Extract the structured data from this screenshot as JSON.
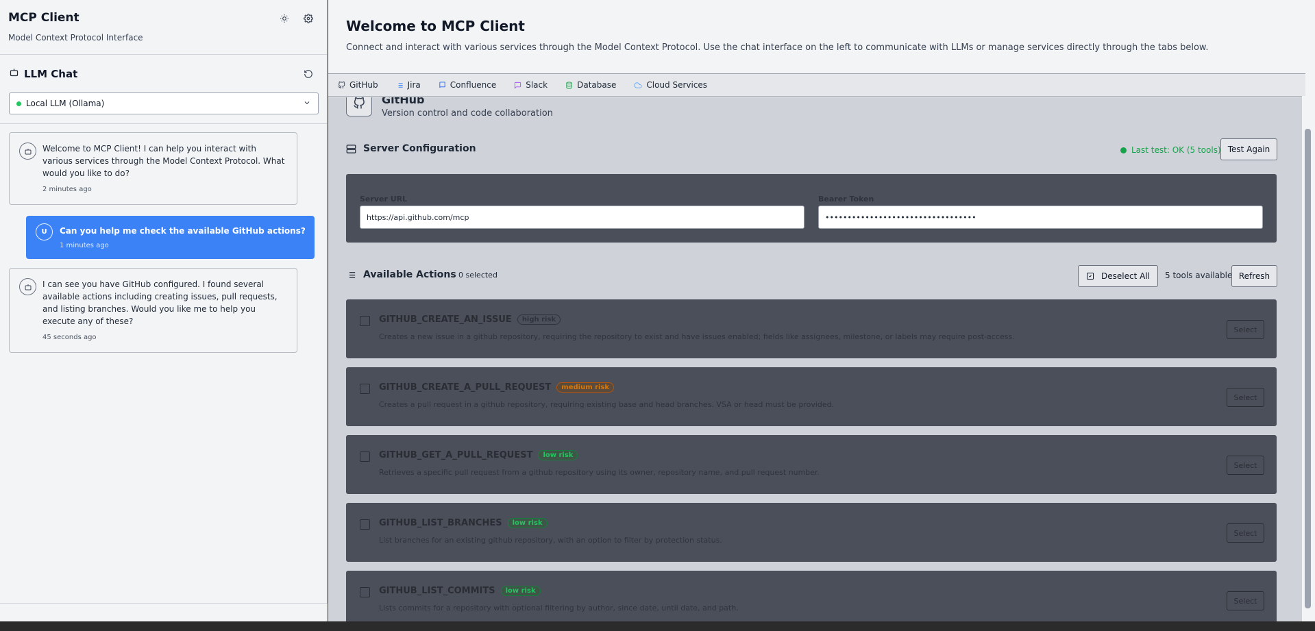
{
  "sidebar": {
    "title": "MCP Client",
    "subtitle": "Model Context Protocol Interface",
    "chat": {
      "title": "LLM Chat",
      "model_select": "Local LLM (Ollama)"
    },
    "messages": [
      {
        "role": "bot",
        "avatar": "",
        "text": "Welcome to MCP Client! I can help you interact with various services through the Model Context Protocol. What would you like to do?",
        "time": "2 minutes ago"
      },
      {
        "role": "user",
        "avatar": "U",
        "text": "Can you help me check the available GitHub actions?",
        "time": "1 minutes ago"
      },
      {
        "role": "bot",
        "avatar": "",
        "text": "I can see you have GitHub configured. I found several available actions including creating issues, pull requests, and listing branches. Would you like me to help you execute any of these?",
        "time": "45 seconds ago"
      }
    ]
  },
  "main": {
    "title": "Welcome to MCP Client",
    "subtitle": "Connect and interact with various services through the Model Context Protocol. Use the chat interface on the left to communicate with LLMs or manage services directly through the tabs below.",
    "tabs": [
      {
        "label": "GitHub",
        "icon": "github-icon"
      },
      {
        "label": "Jira",
        "icon": "list-icon"
      },
      {
        "label": "Confluence",
        "icon": "book-icon"
      },
      {
        "label": "Slack",
        "icon": "chat-icon"
      },
      {
        "label": "Database",
        "icon": "database-icon"
      },
      {
        "label": "Cloud Services",
        "icon": "cloud-icon"
      }
    ],
    "service": {
      "name": "GitHub",
      "description": "Version control and code collaboration"
    },
    "server_config": {
      "title": "Server Configuration",
      "status": "Last test: OK (5 tools)",
      "test_button": "Test Again",
      "url_label": "Server URL",
      "url_value": "https://api.github.com/mcp",
      "token_label": "Bearer Token",
      "token_value": "••••••••••••••••••••••••••••••••••"
    },
    "actions": {
      "title": "Available Actions",
      "selected_count": "0 selected",
      "deselect_button": "Deselect All",
      "tools_available": "5 tools available",
      "refresh_button": "Refresh",
      "select_label": "Select",
      "items": [
        {
          "name": "GITHUB_CREATE_AN_ISSUE",
          "risk": "high risk",
          "level": "high",
          "description": "Creates a new issue in a github repository, requiring the repository to exist and have issues enabled; fields like assignees, milestone, or labels may require post-access."
        },
        {
          "name": "GITHUB_CREATE_A_PULL_REQUEST",
          "risk": "medium risk",
          "level": "medium",
          "description": "Creates a pull request in a github repository, requiring existing base and head branches. VSA or head must be provided."
        },
        {
          "name": "GITHUB_GET_A_PULL_REQUEST",
          "risk": "low risk",
          "level": "low",
          "description": "Retrieves a specific pull request from a github repository using its owner, repository name, and pull request number."
        },
        {
          "name": "GITHUB_LIST_BRANCHES",
          "risk": "low risk",
          "level": "low",
          "description": "List branches for an existing github repository, with an option to filter by protection status."
        },
        {
          "name": "GITHUB_LIST_COMMITS",
          "risk": "low risk",
          "level": "low",
          "description": "Lists commits for a repository with optional filtering by author, since date, until date, and path."
        }
      ]
    }
  },
  "colors": {
    "accent": "#3b82f6",
    "ok": "#16a34a",
    "medium": "#d97706",
    "low": "#22c55e"
  }
}
